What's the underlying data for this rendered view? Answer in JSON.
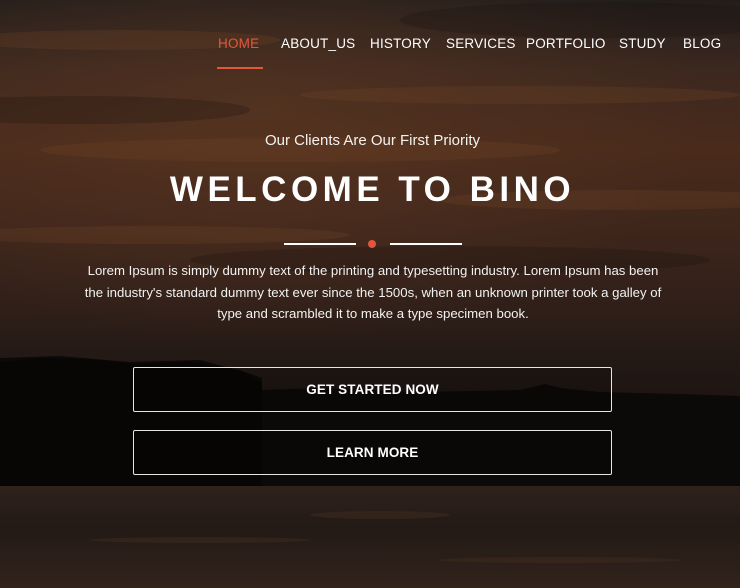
{
  "nav": {
    "items": [
      {
        "label": "HOME",
        "active": true
      },
      {
        "label": "ABOUT_US",
        "active": false
      },
      {
        "label": "HISTORY",
        "active": false
      },
      {
        "label": "SERVICES",
        "active": false
      },
      {
        "label": "PORTFOLIO",
        "active": false
      },
      {
        "label": "STUDY",
        "active": false
      },
      {
        "label": "BLOG",
        "active": false
      }
    ]
  },
  "hero": {
    "tagline": "Our Clients Are Our First Priority",
    "title": "WELCOME TO BINO",
    "description": "Lorem Ipsum is simply dummy text of the printing and typesetting industry. Lorem Ipsum has been the industry's standard dummy text ever since the 1500s, when an unknown printer took a galley of type and scrambled it to make a type specimen book.",
    "primary_button": "GET STARTED NOW",
    "secondary_button": "LEARN MORE"
  },
  "colors": {
    "accent": "#e2563d",
    "text": "#ffffff"
  }
}
